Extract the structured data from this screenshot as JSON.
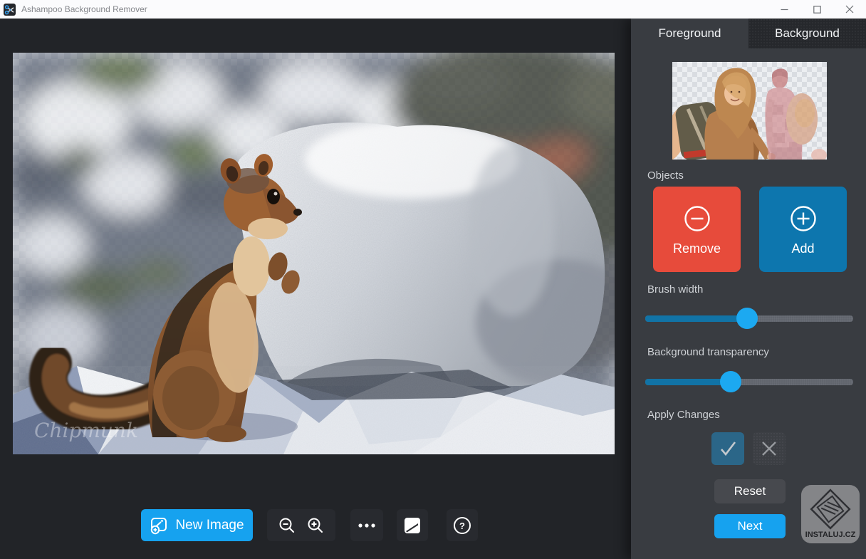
{
  "titlebar": {
    "title": "Ashampoo Background Remover",
    "app_icon": "scissors-icon",
    "controls": [
      "minimize",
      "maximize",
      "close"
    ]
  },
  "sidebar": {
    "tabs": [
      {
        "label": "Foreground",
        "active": true
      },
      {
        "label": "Background",
        "active": false
      }
    ],
    "objects_label": "Objects",
    "remove_button": {
      "label": "Remove",
      "icon": "circle-minus-icon",
      "color": "#e74b3b"
    },
    "add_button": {
      "label": "Add",
      "icon": "circle-plus-icon",
      "color": "#0d76ae"
    },
    "brush_width": {
      "label": "Brush width",
      "percent": 49
    },
    "background_transparency": {
      "label": "Background transparency",
      "percent": 41
    },
    "apply_changes_label": "Apply Changes",
    "apply_buttons": [
      {
        "icon": "check-icon"
      },
      {
        "icon": "x-icon"
      }
    ],
    "reset_button_label": "Reset",
    "next_button_label": "Next"
  },
  "toolbar": {
    "new_image_label": "New Image",
    "icons": [
      "image-plus-icon",
      "zoom-out-icon",
      "zoom-in-icon",
      "ellipsis-icon",
      "compare-icon",
      "help-icon"
    ]
  },
  "canvas": {
    "photo_watermark": "Chipmunk",
    "content": "golden-mantled ground squirrel standing on white granite rocks, blurred forest background marked transparent (checkerboard)"
  },
  "preview": {
    "content": "woman with backpack kept as foreground; man silhouette tinted red marked as removed background"
  },
  "branding": {
    "watermark_text": "INSTALUJ.CZ"
  },
  "colors": {
    "accent_blue": "#16a2ef",
    "remove_red": "#e74b3b",
    "add_blue": "#0d76ae",
    "slider_fill": "#1173a6",
    "slider_thumb": "#1ca9f1",
    "apply_check_bg": "#2b6688",
    "sidebar_bg": "#393c41",
    "app_bg": "#222428",
    "titlebar_bg": "#fbfbfd"
  }
}
